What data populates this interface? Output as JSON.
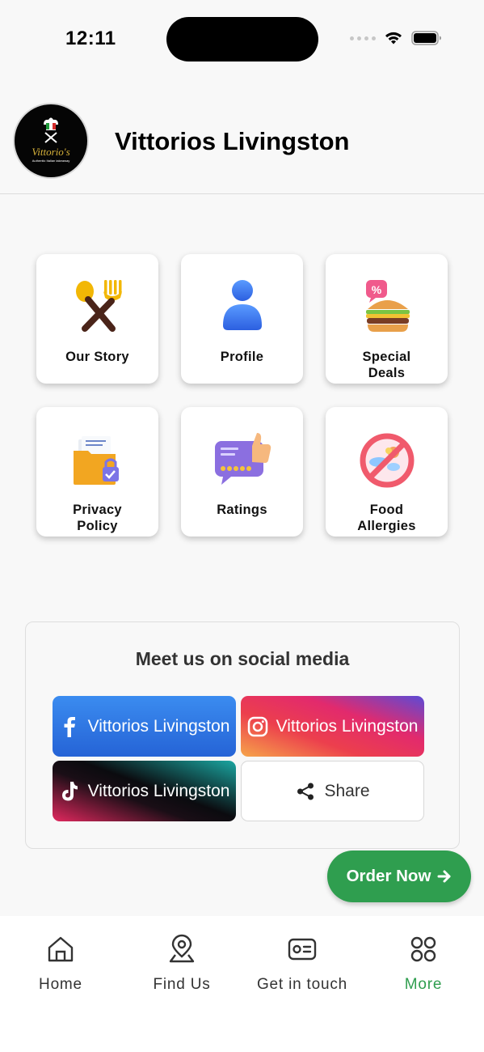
{
  "status_bar": {
    "time": "12:11"
  },
  "header": {
    "title": "Vittorios Livingston",
    "logo_text": "Vittorio's",
    "logo_tagline": "Authentic Italian takeaway"
  },
  "tiles": [
    {
      "label": "Our Story",
      "icon": "fork-spoon-icon"
    },
    {
      "label": "Profile",
      "icon": "person-icon"
    },
    {
      "label": "Special\nDeals",
      "icon": "burger-deal-icon"
    },
    {
      "label": "Privacy\nPolicy",
      "icon": "folder-lock-icon"
    },
    {
      "label": "Ratings",
      "icon": "rating-thumbs-up-icon"
    },
    {
      "label": "Food\nAllergies",
      "icon": "no-allergen-icon"
    }
  ],
  "social": {
    "title": "Meet us on social media",
    "facebook_label": "Vittorios Livingston",
    "instagram_label": "Vittorios Livingston",
    "tiktok_label": "Vittorios Livingston",
    "share_label": "Share"
  },
  "order_now": {
    "label": "Order Now"
  },
  "bottom_nav": {
    "items": [
      {
        "label": "Home",
        "icon": "home-icon"
      },
      {
        "label": "Find Us",
        "icon": "location-pin-icon"
      },
      {
        "label": "Get in touch",
        "icon": "contact-card-icon"
      },
      {
        "label": "More",
        "icon": "grid-icon"
      }
    ],
    "active_index": 3,
    "active_color": "#2f9e4f"
  },
  "colors": {
    "accent_green": "#2f9e4f",
    "facebook_blue": "#2f76e6",
    "background": "#f8f8f8"
  }
}
